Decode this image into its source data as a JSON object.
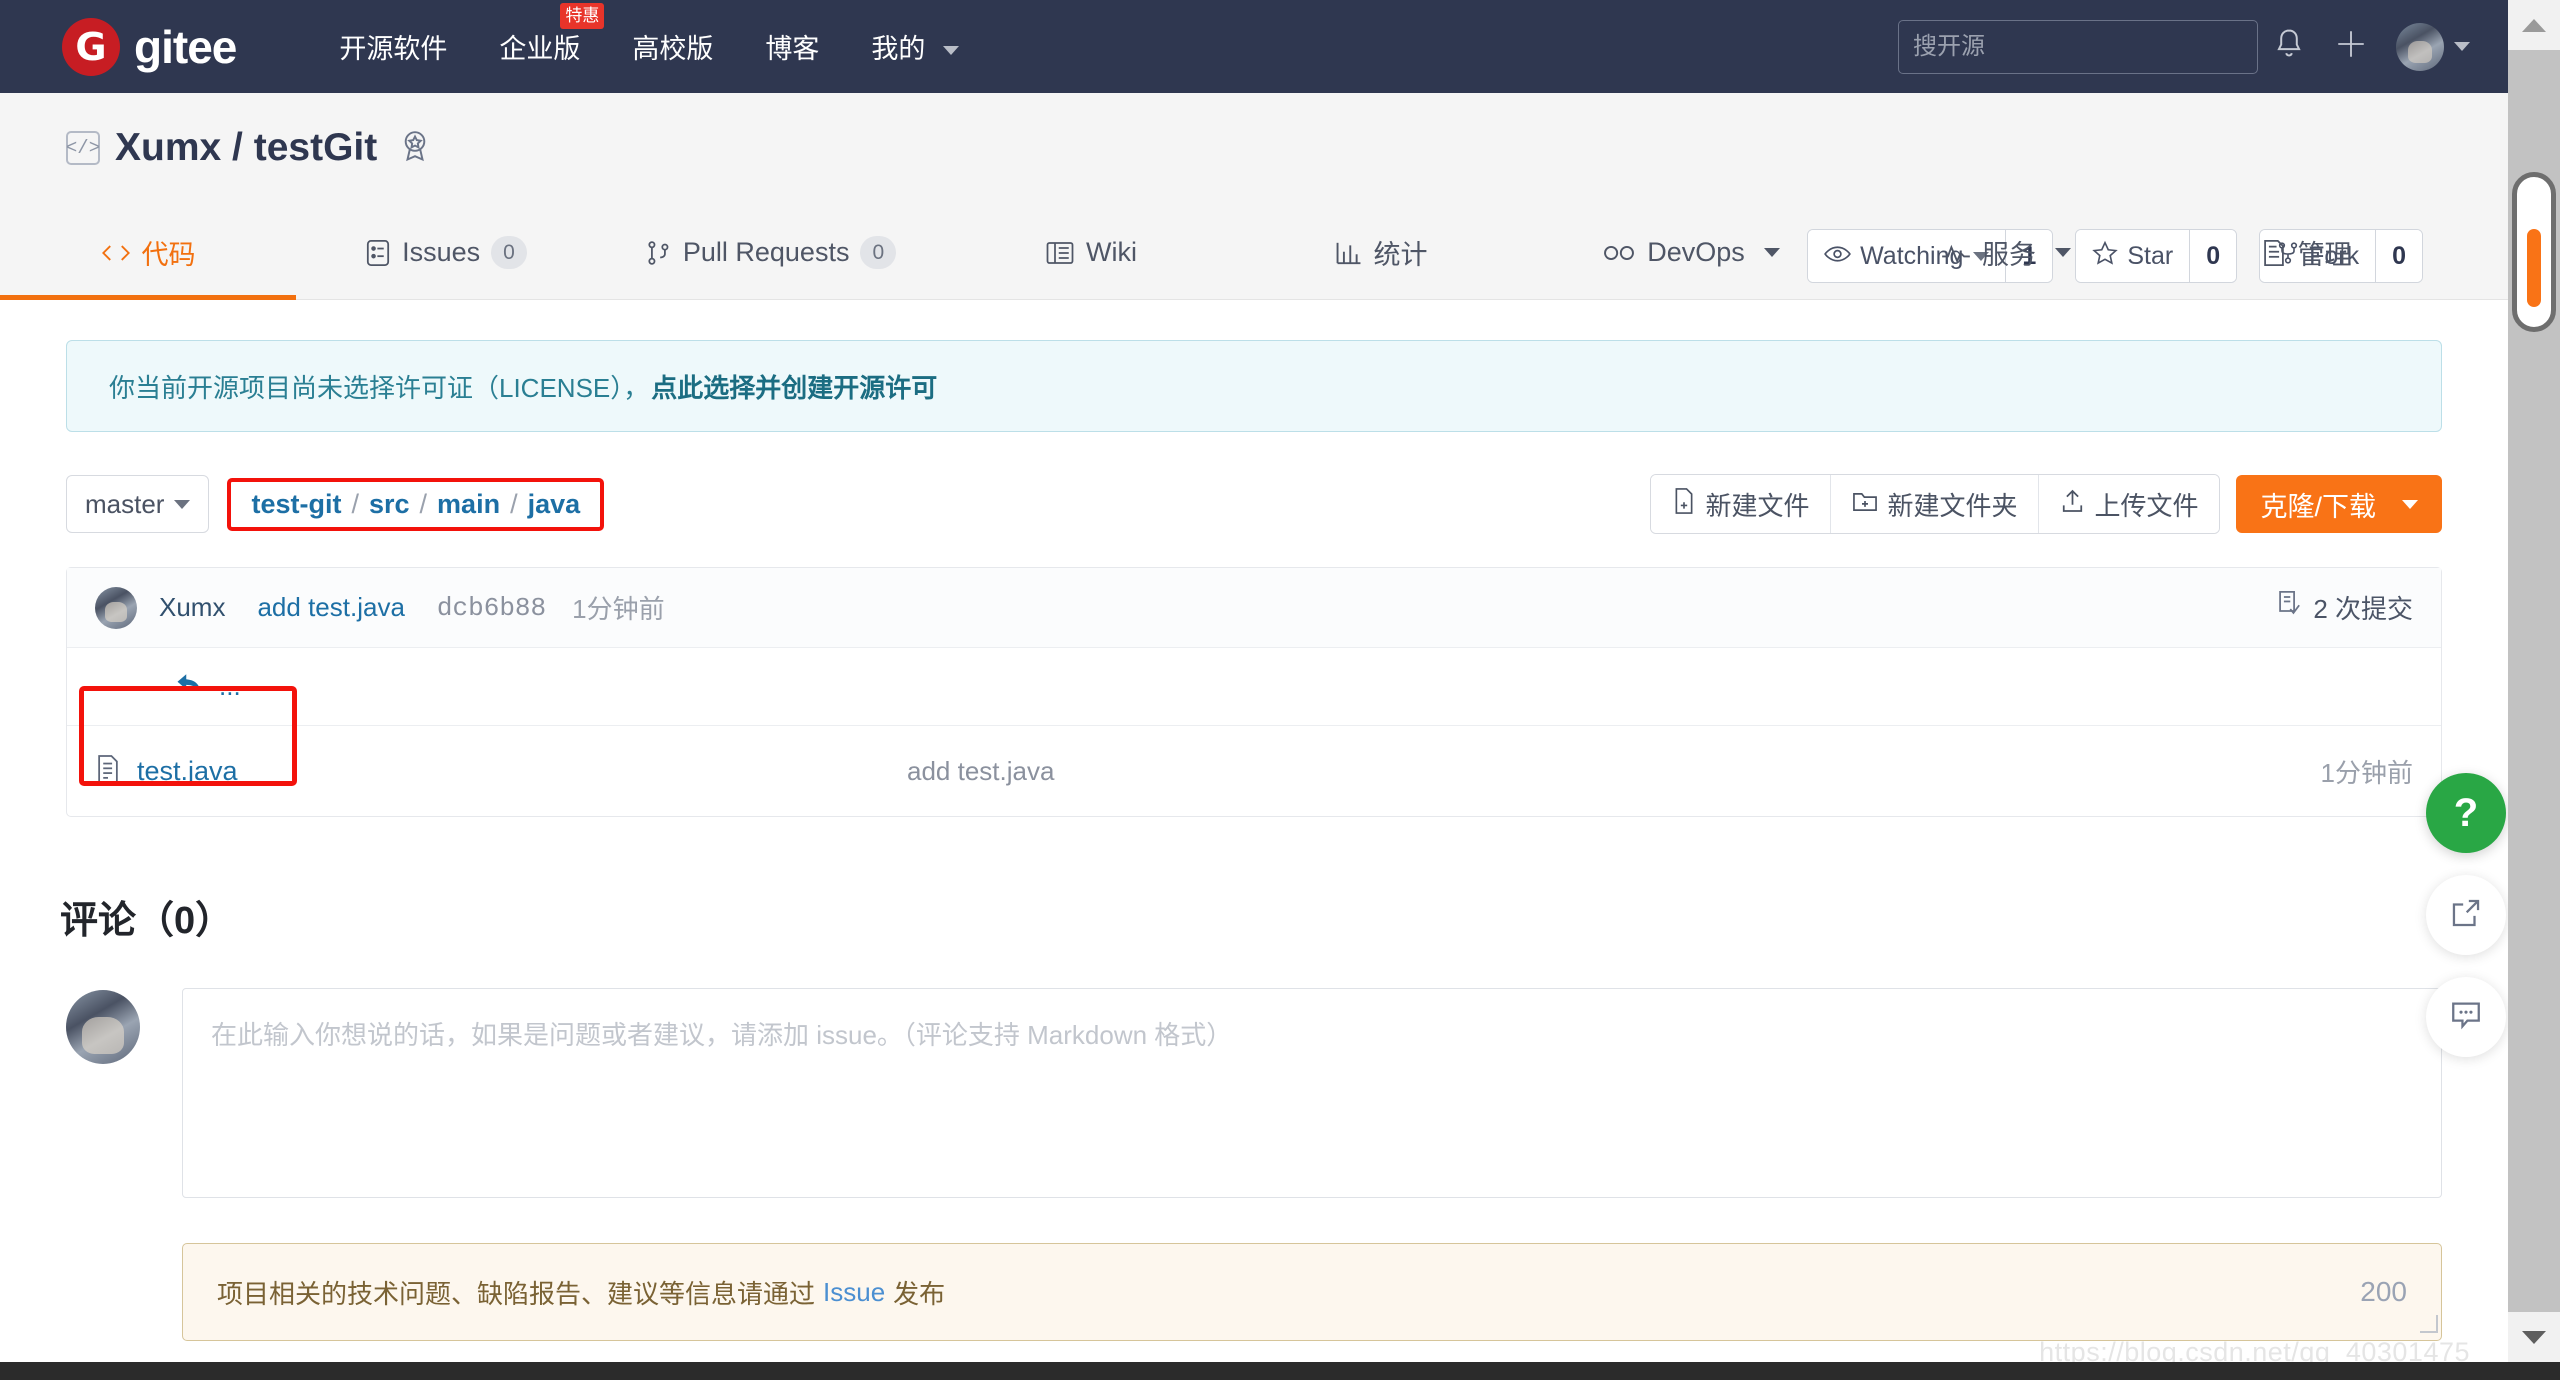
{
  "topnav": {
    "brand": {
      "logo_letter": "G",
      "name": "gitee"
    },
    "links": [
      {
        "label": "开源软件",
        "badge": null,
        "has_caret": false
      },
      {
        "label": "企业版",
        "badge": "特惠",
        "has_caret": false
      },
      {
        "label": "高校版",
        "badge": null,
        "has_caret": false
      },
      {
        "label": "博客",
        "badge": null,
        "has_caret": false
      },
      {
        "label": "我的",
        "badge": null,
        "has_caret": true
      }
    ],
    "search": {
      "placeholder": "搜开源",
      "value": ""
    },
    "icons": {
      "bell": "bell-icon",
      "plus": "plus-icon",
      "avatar": "user-avatar"
    }
  },
  "repo": {
    "owner": "Xumx",
    "separator": "/",
    "name": "testGit",
    "type_icon": "</>",
    "badge_icon": "award-ribbon-icon",
    "actions": [
      {
        "id": "watching",
        "label": "Watching",
        "count": "1",
        "icon": "eye-icon",
        "has_caret": true
      },
      {
        "id": "star",
        "label": "Star",
        "count": "0",
        "icon": "star-icon",
        "has_caret": false
      },
      {
        "id": "fork",
        "label": "Fork",
        "count": "0",
        "icon": "fork-icon",
        "has_caret": false
      }
    ]
  },
  "tabs": [
    {
      "id": "code",
      "label": "代码",
      "icon": "code-icon",
      "count": null,
      "active": true,
      "caret": false
    },
    {
      "id": "issues",
      "label": "Issues",
      "icon": "issue-icon",
      "count": "0",
      "active": false,
      "caret": false
    },
    {
      "id": "pulls",
      "label": "Pull Requests",
      "icon": "pull-request-icon",
      "count": "0",
      "active": false,
      "caret": false
    },
    {
      "id": "wiki",
      "label": "Wiki",
      "icon": "book-icon",
      "count": null,
      "active": false,
      "caret": false
    },
    {
      "id": "stats",
      "label": "统计",
      "icon": "chart-icon",
      "count": null,
      "active": false,
      "caret": false
    },
    {
      "id": "devops",
      "label": "DevOps",
      "icon": "infinity-icon",
      "count": null,
      "active": false,
      "caret": true
    },
    {
      "id": "service",
      "label": "服务",
      "icon": "pulse-icon",
      "count": null,
      "active": false,
      "caret": true
    },
    {
      "id": "manage",
      "label": "管理",
      "icon": "settings-doc-icon",
      "count": null,
      "active": false,
      "caret": false
    }
  ],
  "license_alert": {
    "text": "你当前开源项目尚未选择许可证（LICENSE），",
    "link": "点此选择并创建开源许可"
  },
  "file_toolbar": {
    "branch": "master",
    "breadcrumb": [
      {
        "label": "test-git",
        "link": true
      },
      {
        "label": "src",
        "link": true
      },
      {
        "label": "main",
        "link": true
      },
      {
        "label": "java",
        "link": true
      }
    ],
    "breadcrumb_separator": "/",
    "buttons": [
      {
        "id": "new-file",
        "label": "新建文件",
        "icon": "file-plus-icon"
      },
      {
        "id": "new-folder",
        "label": "新建文件夹",
        "icon": "folder-plus-icon"
      },
      {
        "id": "upload-file",
        "label": "上传文件",
        "icon": "upload-icon"
      }
    ],
    "clone_button": {
      "label": "克隆/下载",
      "color": "#f97316"
    }
  },
  "commit_bar": {
    "author": "Xumx",
    "message": "add test.java",
    "sha": "dcb6b88",
    "time": "1分钟前",
    "commit_count": "2 次提交",
    "commit_count_icon": "commit-history-icon"
  },
  "file_list": {
    "parent_dir_label": "...",
    "parent_dir_icon": "arrow-up-left-icon",
    "files": [
      {
        "name": "test.java",
        "icon": "file-code-icon",
        "commit_message": "add test.java",
        "time": "1分钟前",
        "highlighted": true
      }
    ]
  },
  "comments": {
    "title": "评论（0）",
    "textarea_placeholder": "在此输入你想说的话，如果是问题或者建议，请添加 issue。（评论支持 Markdown 格式）",
    "textarea_value": "",
    "notice_prefix": "项目相关的技术问题、缺陷报告、建议等信息请通过",
    "notice_link": "Issue",
    "notice_suffix": "发布",
    "char_limit": "200"
  },
  "float_buttons": [
    {
      "id": "help",
      "label": "?",
      "icon": "question-mark-icon",
      "color": "#29a745"
    },
    {
      "id": "share",
      "label": "",
      "icon": "share-external-icon",
      "color": "#ffffff"
    },
    {
      "id": "feedback",
      "label": "",
      "icon": "comment-dots-icon",
      "color": "#ffffff"
    }
  ],
  "watermark": {
    "text": "https://blog.csdn.net/qq_40301475"
  },
  "colors": {
    "navbar_bg": "#2f3750",
    "accent_orange": "#f2700f",
    "link_blue": "#1d6fa5",
    "highlight_red": "#f3120b",
    "brand_red": "#c71d23"
  }
}
